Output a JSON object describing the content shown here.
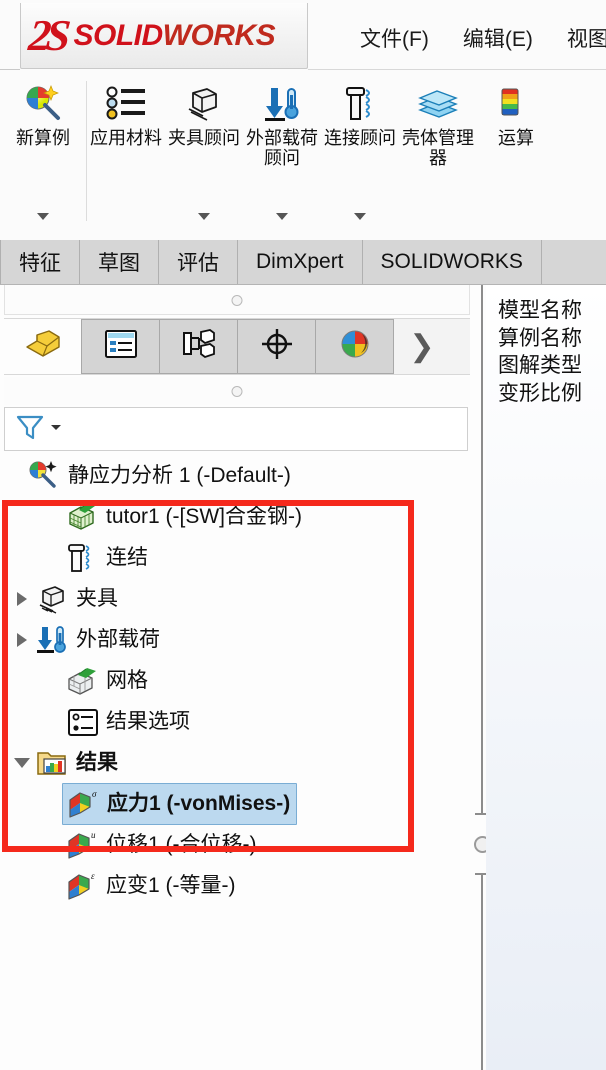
{
  "app": {
    "brand_ds": "2S",
    "brand_solid": "SOLID",
    "brand_works": "WORKS"
  },
  "menubar": {
    "items": [
      {
        "label": "文件(F)"
      },
      {
        "label": "编辑(E)"
      },
      {
        "label": "视图"
      }
    ]
  },
  "ribbon": {
    "groups": [
      {
        "buttons": [
          {
            "label": "新算例",
            "icon": "new-study-icon",
            "dropdown": true
          }
        ]
      },
      {
        "buttons": [
          {
            "label": "应用材料",
            "icon": "apply-material-icon",
            "dropdown": false
          },
          {
            "label": "夹具顾问",
            "icon": "fixture-advisor-icon",
            "dropdown": true
          },
          {
            "label": "外部载荷顾问",
            "icon": "external-loads-advisor-icon",
            "dropdown": true
          },
          {
            "label": "连接顾问",
            "icon": "connections-advisor-icon",
            "dropdown": true
          },
          {
            "label": "壳体管理器",
            "icon": "shell-manager-icon",
            "dropdown": false
          },
          {
            "label": "运算",
            "icon": "run-study-icon",
            "dropdown": false
          }
        ]
      }
    ]
  },
  "command_tabs": {
    "items": [
      {
        "label": "特征",
        "active": false
      },
      {
        "label": "草图",
        "active": false
      },
      {
        "label": "评估",
        "active": false
      },
      {
        "label": "DimXpert",
        "active": false
      },
      {
        "label": "SOLIDWORKS",
        "active": false
      }
    ]
  },
  "feature_tabs": {
    "items": [
      {
        "name": "feature-manager-tab",
        "icon": "yellow-part-icon",
        "active": true
      },
      {
        "name": "property-manager-tab",
        "icon": "property-list-icon",
        "active": false
      },
      {
        "name": "configuration-manager-tab",
        "icon": "configuration-tree-icon",
        "active": false
      },
      {
        "name": "dimxpert-manager-tab",
        "icon": "crosshair-target-icon",
        "active": false
      },
      {
        "name": "display-manager-tab",
        "icon": "color-sphere-icon",
        "active": false
      }
    ],
    "overflow_label": "❯"
  },
  "filter_bar": {
    "icon": "filter-funnel-icon",
    "dropdown_icon": "chevron-down-icon"
  },
  "tree": {
    "items": [
      {
        "label": "静应力分析 1 (-Default-)",
        "icon": "static-study-icon",
        "indent": 0,
        "expander": "none",
        "bold": false,
        "selected": false
      },
      {
        "label": "tutor1 (-[SW]合金钢-)",
        "icon": "part-mesh-green-icon",
        "indent": 1,
        "expander": "none",
        "bold": false,
        "selected": false
      },
      {
        "label": "连结",
        "icon": "connections-bolt-icon",
        "indent": 1,
        "expander": "none",
        "bold": false,
        "selected": false
      },
      {
        "label": "夹具",
        "icon": "fixtures-icon",
        "indent": 1,
        "expander": "right",
        "bold": false,
        "selected": false
      },
      {
        "label": "外部载荷",
        "icon": "external-loads-icon",
        "indent": 1,
        "expander": "right",
        "bold": false,
        "selected": false
      },
      {
        "label": "网格",
        "icon": "mesh-icon",
        "indent": 1,
        "expander": "none",
        "bold": false,
        "selected": false
      },
      {
        "label": "结果选项",
        "icon": "result-options-icon",
        "indent": 1,
        "expander": "none",
        "bold": false,
        "selected": false
      },
      {
        "label": "结果",
        "icon": "results-folder-icon",
        "indent": 1,
        "expander": "down",
        "bold": true,
        "selected": false
      },
      {
        "label": "应力1 (-vonMises-)",
        "icon": "stress-plot-icon",
        "indent": 2,
        "expander": "none",
        "bold": true,
        "selected": true
      },
      {
        "label": "位移1 (-合位移-)",
        "icon": "displacement-plot-icon",
        "indent": 2,
        "expander": "none",
        "bold": false,
        "selected": false
      },
      {
        "label": "应变1 (-等量-)",
        "icon": "strain-plot-icon",
        "indent": 2,
        "expander": "none",
        "bold": false,
        "selected": false
      }
    ]
  },
  "annotation": {
    "highlight_color": "#f5291c"
  },
  "right_panel": {
    "lines": "模型名称\n算例名称\n图解类型\n变形比例"
  }
}
